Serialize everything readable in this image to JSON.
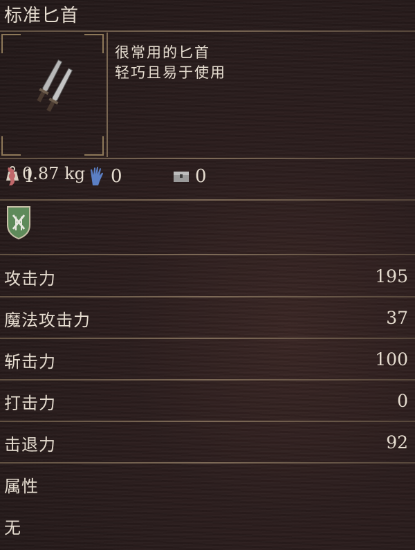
{
  "item": {
    "name": "标准匕首",
    "icon": "daggers-icon",
    "weight": "0.87 kg",
    "description": [
      "很常用的匕首",
      "轻巧且易于使用"
    ]
  },
  "requirements": [
    {
      "icon": "strength-icon",
      "color": "#c0686a",
      "value": "1"
    },
    {
      "icon": "dexterity-hand-icon",
      "color": "#5b7fc4",
      "value": "0"
    },
    {
      "icon": "chest-icon",
      "color": "#a9a9a9",
      "value": "0"
    }
  ],
  "attribute_icon": "crossed-daggers-shield-icon",
  "stats": [
    {
      "label": "攻击力",
      "value": "195"
    },
    {
      "label": "魔法攻击力",
      "value": "37"
    },
    {
      "label": "斩击力",
      "value": "100"
    },
    {
      "label": "打击力",
      "value": "0"
    },
    {
      "label": "击退力",
      "value": "92"
    }
  ],
  "element": {
    "label": "属性",
    "value": "无"
  }
}
